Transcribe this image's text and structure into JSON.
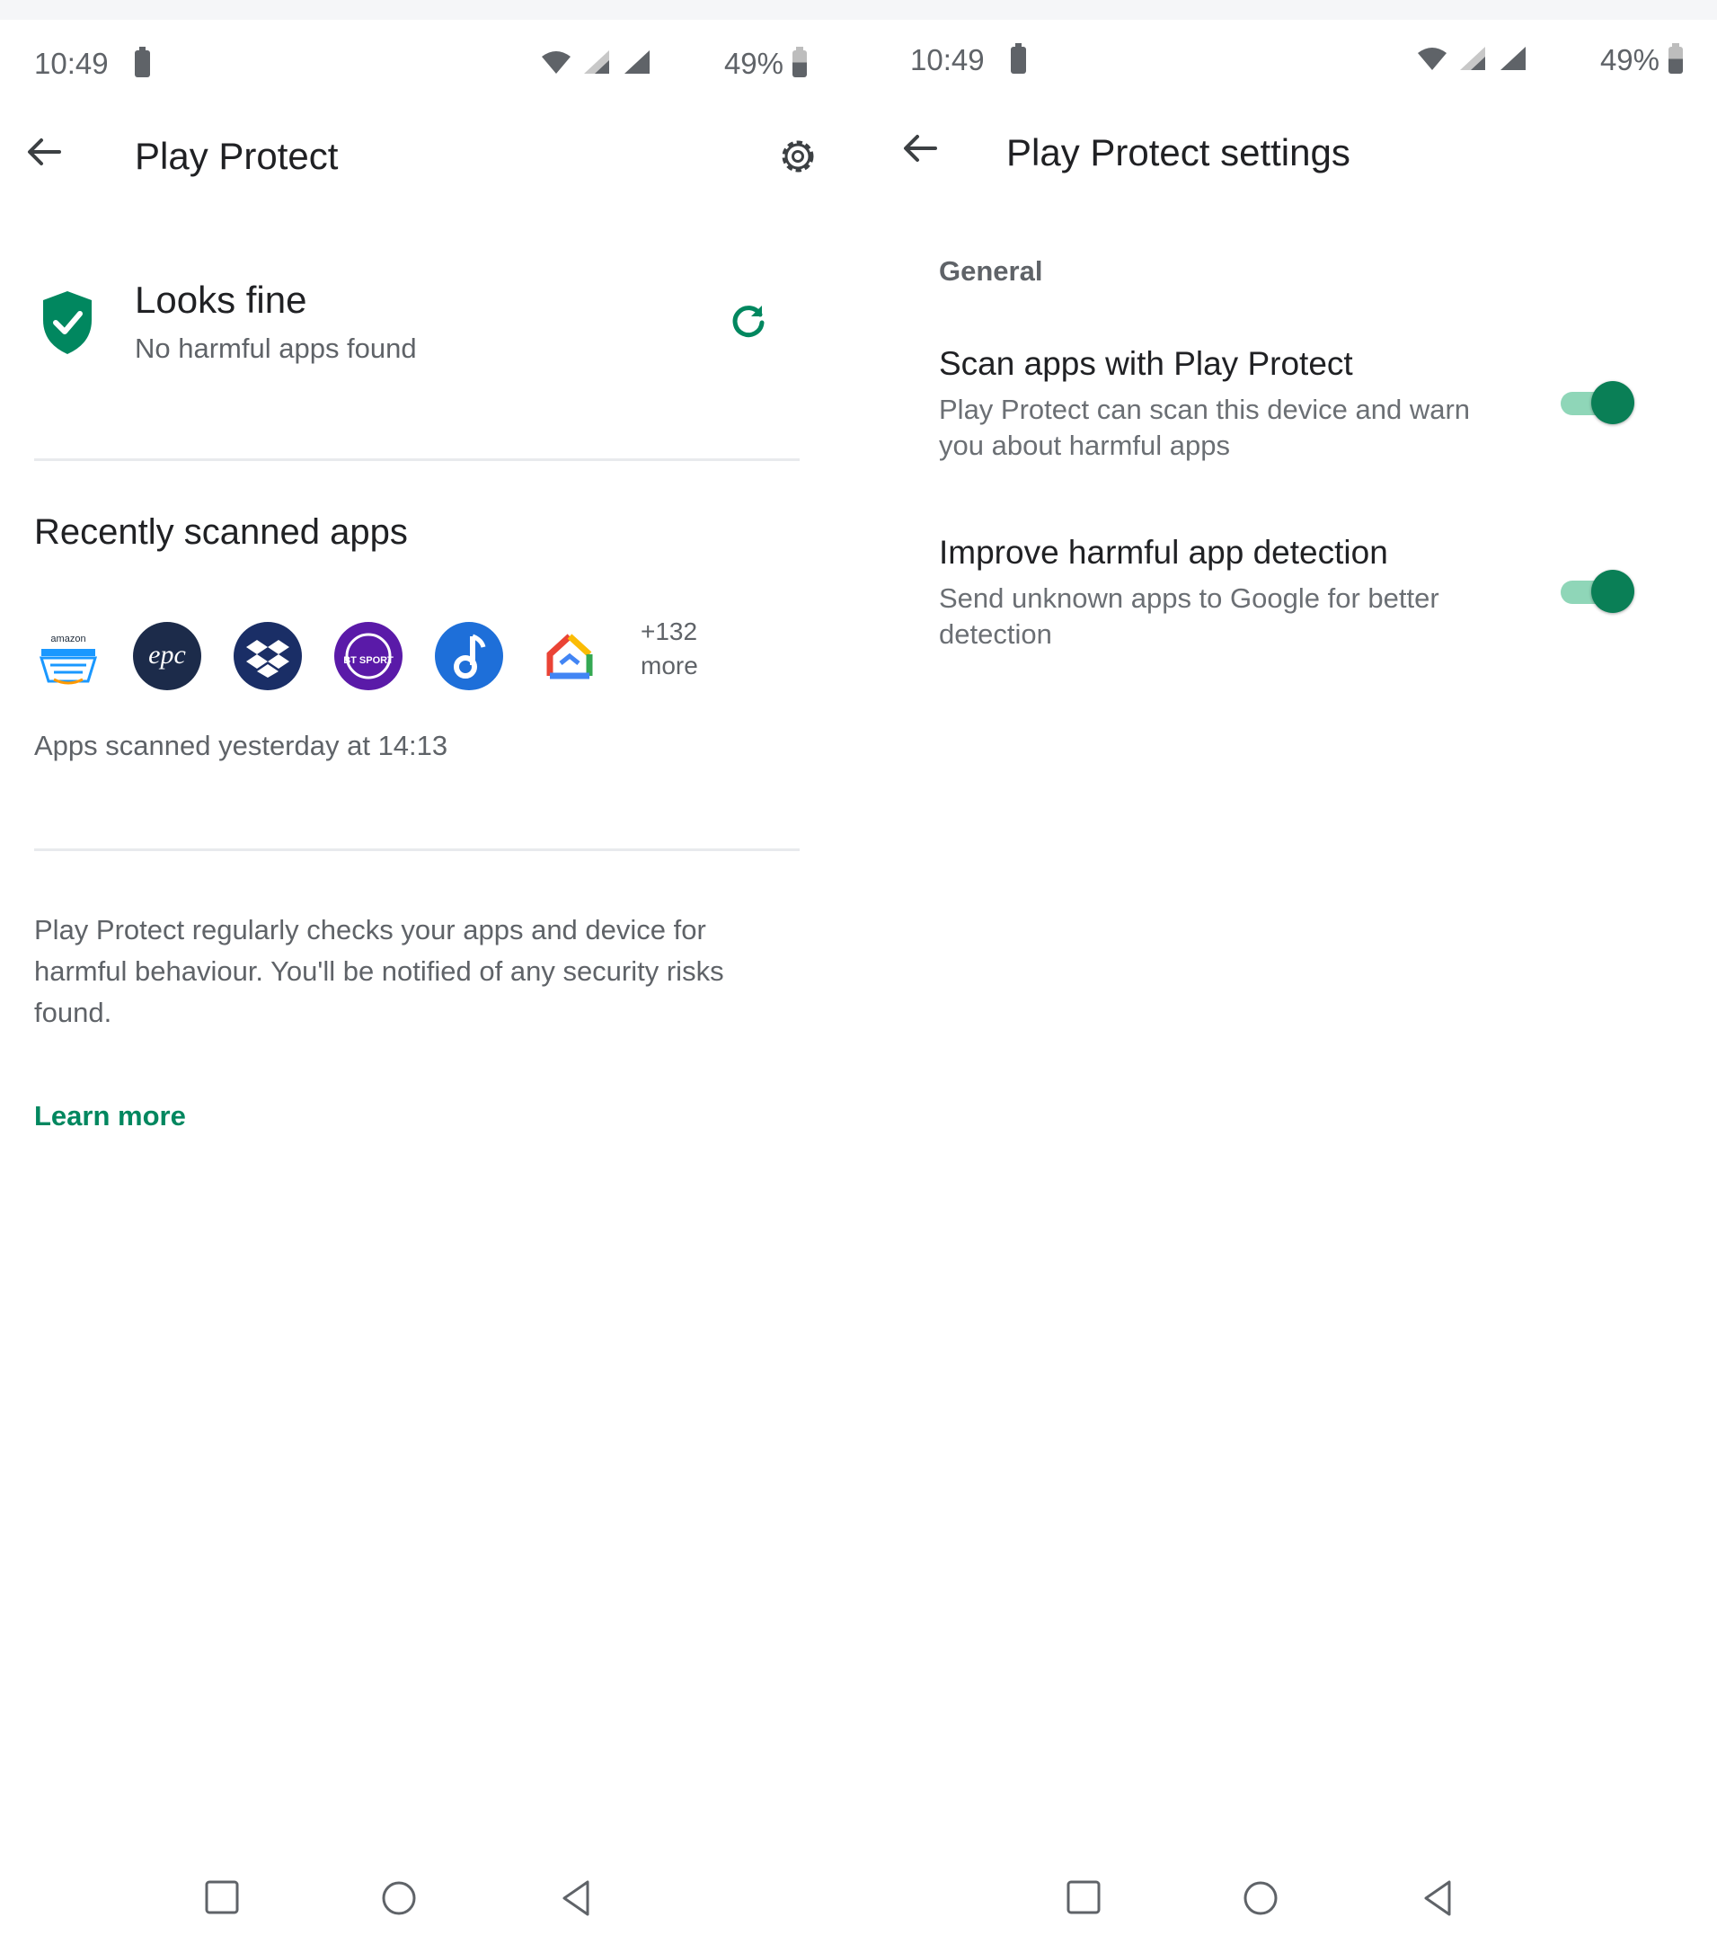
{
  "left": {
    "status_bar": {
      "time": "10:49",
      "battery_percent": "49%"
    },
    "app_bar": {
      "title": "Play Protect"
    },
    "status_card": {
      "title": "Looks fine",
      "subtitle": "No harmful apps found"
    },
    "recent": {
      "heading": "Recently scanned apps",
      "more_count": "+132",
      "more_label": "more",
      "apps": [
        {
          "name": "amazon-app-icon",
          "text": "amazon"
        },
        {
          "name": "epc-app-icon",
          "text": "epc"
        },
        {
          "name": "dropbox-app-icon"
        },
        {
          "name": "bt-sport-app-icon",
          "text": "BT SPORT"
        },
        {
          "name": "music-app-icon"
        },
        {
          "name": "google-home-app-icon"
        }
      ],
      "scanned_time": "Apps scanned yesterday at 14:13"
    },
    "description": "Play Protect regularly checks your apps and device for harmful behaviour. You'll be notified of any security risks found.",
    "learn_more": "Learn more"
  },
  "right": {
    "status_bar": {
      "time": "10:49",
      "battery_percent": "49%"
    },
    "app_bar": {
      "title": "Play Protect settings"
    },
    "section": "General",
    "settings": [
      {
        "title": "Scan apps with Play Protect",
        "summary": "Play Protect can scan this device and warn you about harmful apps",
        "enabled": true
      },
      {
        "title": "Improve harmful app detection",
        "summary": "Send unknown apps to Google for better detection",
        "enabled": true
      }
    ]
  },
  "colors": {
    "accent": "#01875f",
    "toggle_thumb": "#0a7f56",
    "toggle_track": "#8fd6b8"
  }
}
